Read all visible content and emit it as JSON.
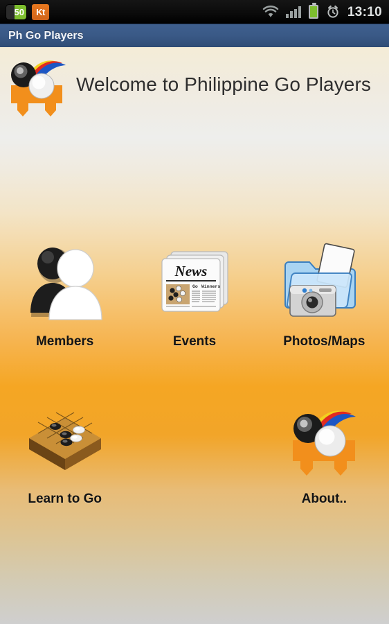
{
  "statusbar": {
    "notifications": [
      {
        "name": "count-badge",
        "label": "50"
      },
      {
        "name": "kt-app-badge",
        "label": "Kt"
      }
    ],
    "icons": [
      "wifi-icon",
      "signal-icon",
      "battery-icon",
      "alarm-clock-icon"
    ],
    "time": "13:10"
  },
  "titlebar": {
    "title": "Ph Go Players"
  },
  "header": {
    "logo_icon": "go-players-logo-icon",
    "welcome": "Welcome to Philippine Go Players"
  },
  "menu": {
    "rows": [
      [
        {
          "label": "Members",
          "icon": "members-people-icon"
        },
        {
          "label": "Events",
          "icon": "events-newspaper-icon"
        },
        {
          "label": "Photos/Maps",
          "icon": "photos-folder-camera-icon"
        }
      ],
      [
        {
          "label": "Learn to Go",
          "icon": "go-board-icon"
        },
        {
          "label": "",
          "icon": ""
        },
        {
          "label": "About..",
          "icon": "go-players-logo-icon"
        }
      ]
    ]
  },
  "newspaper": {
    "masthead": "News",
    "headline_left": "Go",
    "headline_right": "Winners"
  },
  "colors": {
    "titlebar_blue": "#3a5986",
    "accent_orange": "#f5a623",
    "logo_orange": "#f28f1c",
    "battery_green": "#7dbe2e",
    "status_black": "#000000",
    "label_text": "#141414"
  }
}
